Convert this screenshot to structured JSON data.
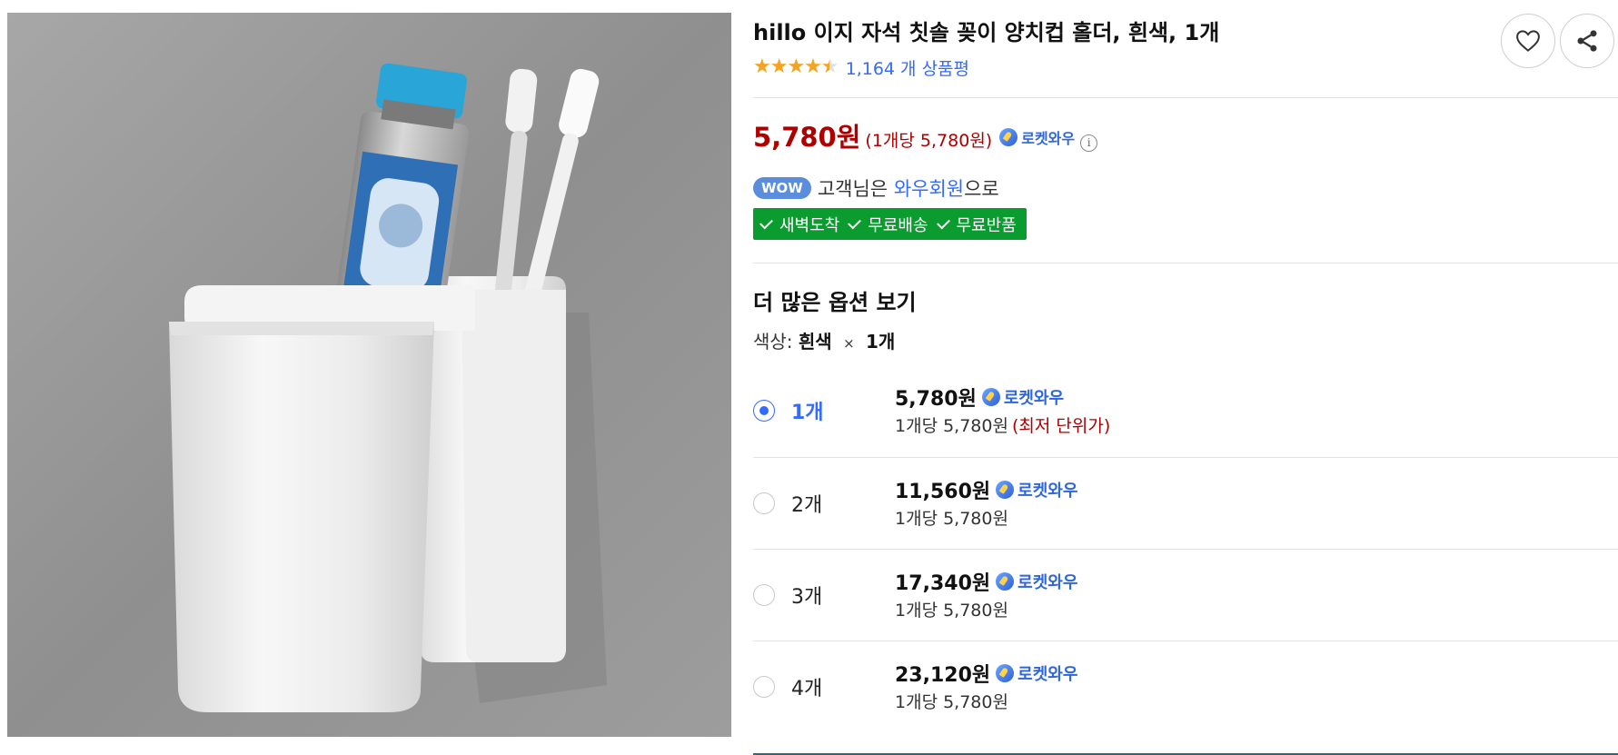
{
  "product": {
    "title": "hillo 이지 자석 칫솔 꽂이 양치컵 홀더, 흰색, 1개",
    "rating": 4.5,
    "review_text": "1,164 개 상품평",
    "price": "5,780원",
    "unit_price": "(1개당 5,780원)",
    "rocket_label": "로켓와우",
    "info_symbol": "i"
  },
  "wow": {
    "badge": "WOW",
    "prefix": "고객님은 ",
    "highlight": "와우회원",
    "suffix": "으로"
  },
  "benefits": [
    "새벽도착",
    "무료배송",
    "무료반품"
  ],
  "options_section": {
    "title": "더 많은 옵션 보기",
    "selection_label": "색상:",
    "selection_value": "흰색",
    "times": "×",
    "selection_qty": "1개"
  },
  "options": [
    {
      "qty": "1개",
      "price": "5,780원",
      "rocket": "로켓와우",
      "unit": "1개당 5,780원",
      "note": "(최저 단위가)",
      "selected": true
    },
    {
      "qty": "2개",
      "price": "11,560원",
      "rocket": "로켓와우",
      "unit": "1개당 5,780원",
      "note": "",
      "selected": false
    },
    {
      "qty": "3개",
      "price": "17,340원",
      "rocket": "로켓와우",
      "unit": "1개당 5,780원",
      "note": "",
      "selected": false
    },
    {
      "qty": "4개",
      "price": "23,120원",
      "rocket": "로켓와우",
      "unit": "1개당 5,780원",
      "note": "",
      "selected": false
    }
  ],
  "colors": {
    "price_red": "#ae0000",
    "link_blue": "#346aff",
    "benefit_green": "#0b9c2f",
    "star_orange": "#f7a41d"
  },
  "icons": [
    "heart-icon",
    "share-icon",
    "rocket-icon",
    "info-icon",
    "check-icon",
    "star-icon"
  ]
}
